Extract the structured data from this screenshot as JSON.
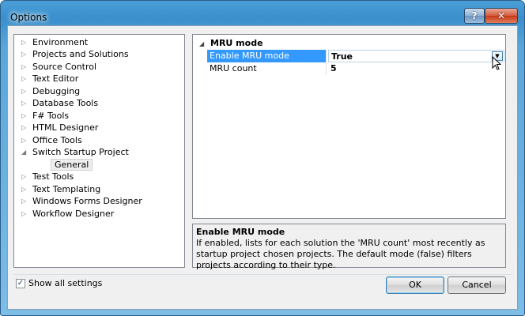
{
  "window": {
    "title": "Options",
    "help_label": "?",
    "close_label": "✕"
  },
  "tree": {
    "items": [
      {
        "label": "Environment"
      },
      {
        "label": "Projects and Solutions"
      },
      {
        "label": "Source Control"
      },
      {
        "label": "Text Editor"
      },
      {
        "label": "Debugging"
      },
      {
        "label": "Database Tools"
      },
      {
        "label": "F# Tools"
      },
      {
        "label": "HTML Designer"
      },
      {
        "label": "Office Tools"
      },
      {
        "label": "Switch Startup Project"
      },
      {
        "label": "General"
      },
      {
        "label": "Test Tools"
      },
      {
        "label": "Text Templating"
      },
      {
        "label": "Windows Forms Designer"
      },
      {
        "label": "Workflow Designer"
      }
    ]
  },
  "grid": {
    "category": "MRU mode",
    "rows": [
      {
        "name": "Enable MRU mode",
        "value": "True"
      },
      {
        "name": "MRU count",
        "value": "5"
      }
    ]
  },
  "description": {
    "title": "Enable MRU mode",
    "text": "If enabled, lists for each solution the 'MRU count' most recently as startup project chosen projects. The default mode (false) filters projects according to their type."
  },
  "footer": {
    "show_all_label": "Show all settings",
    "show_all_checked": true,
    "ok_label": "OK",
    "cancel_label": "Cancel"
  },
  "icons": {
    "tree_collapsed": "triangle-right-icon",
    "tree_expanded": "triangle-down-icon",
    "dropdown": "chevron-down-icon"
  },
  "colors": {
    "selection": "#3399ff",
    "title_bar": "#4a9fd8"
  }
}
